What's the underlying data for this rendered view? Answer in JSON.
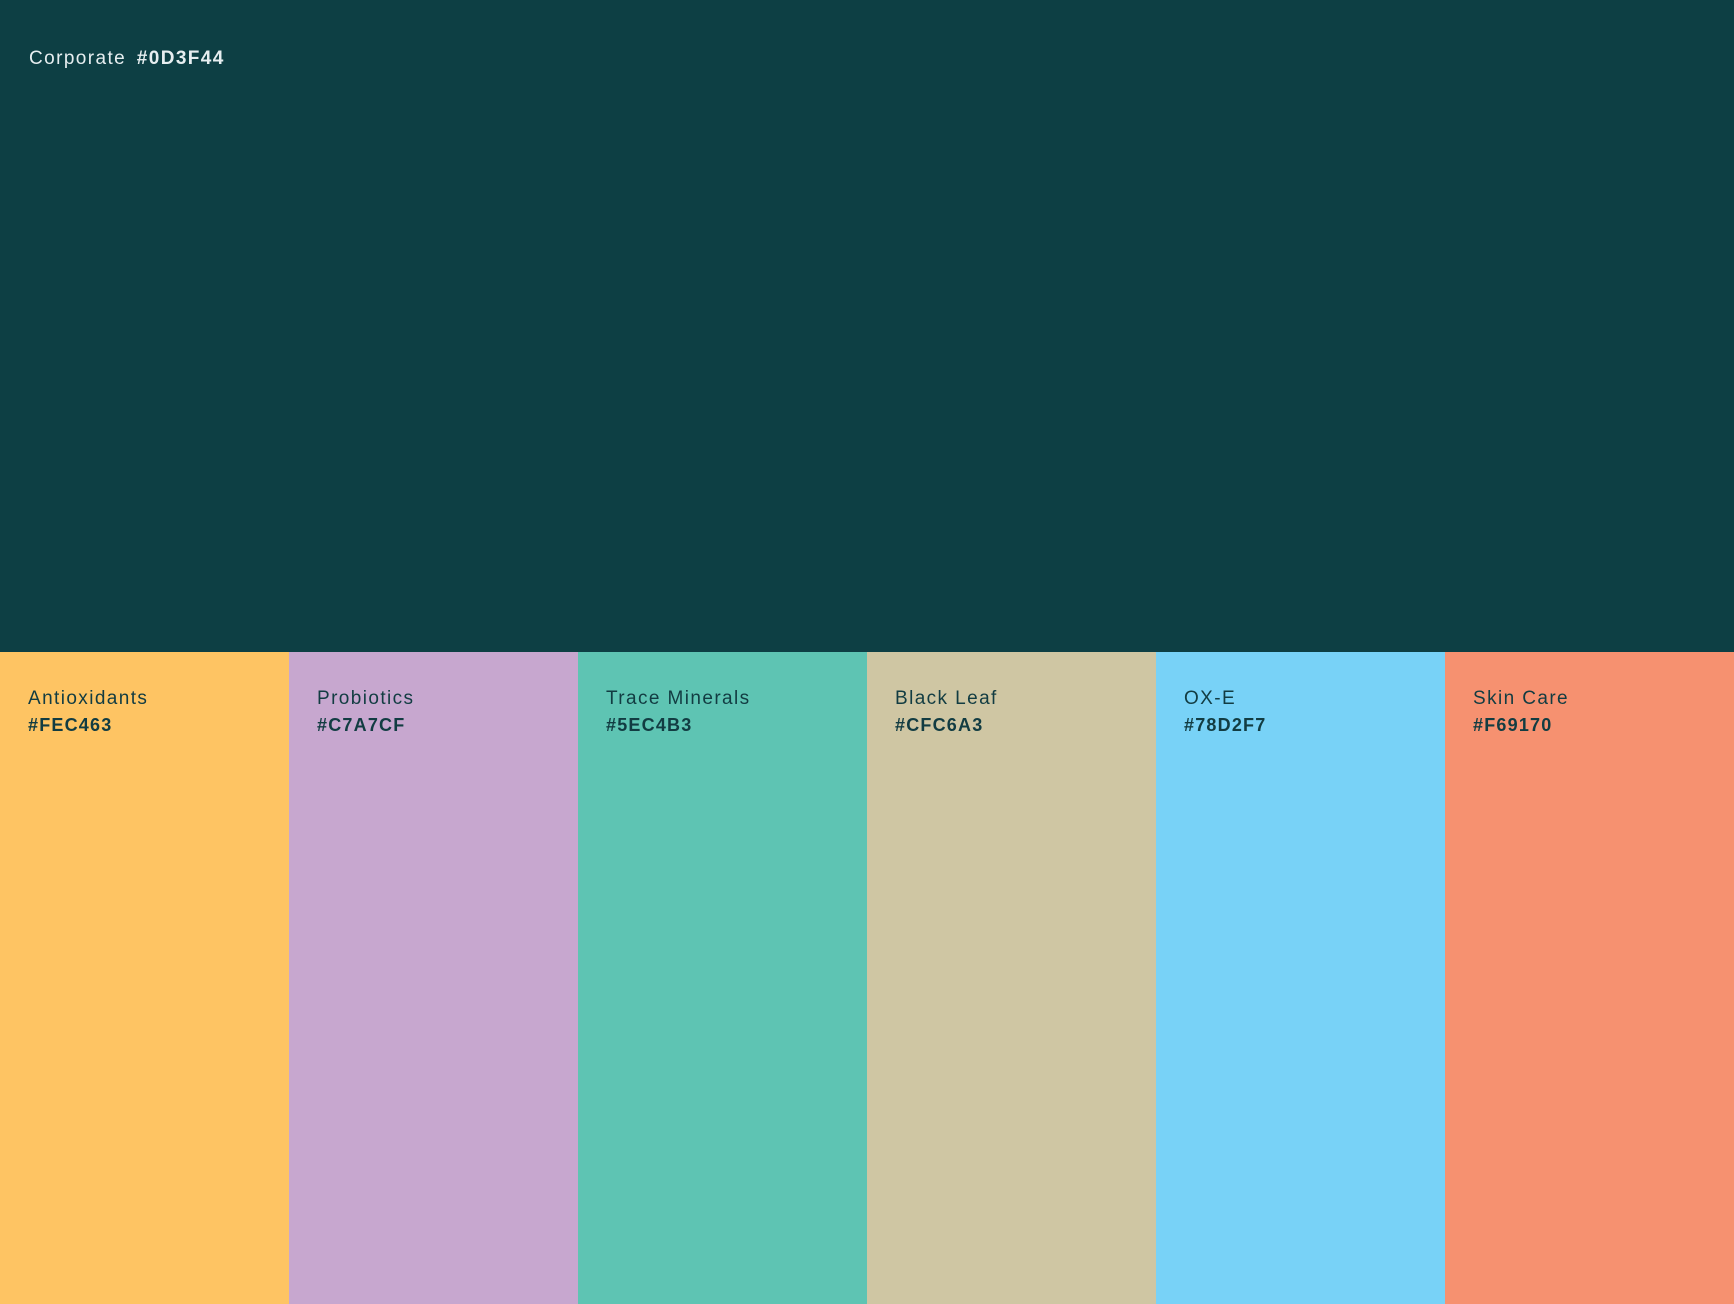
{
  "primary": {
    "name": "Corporate",
    "hex": "#0D3F44",
    "color": "#0D3F44"
  },
  "swatches": [
    {
      "name": "Antioxidants",
      "hex": "#FEC463",
      "color": "#FEC463"
    },
    {
      "name": "Probiotics",
      "hex": "#C7A7CF",
      "color": "#C7A7CF"
    },
    {
      "name": "Trace Minerals",
      "hex": "#5EC4B3",
      "color": "#5EC4B3"
    },
    {
      "name": "Black Leaf",
      "hex": "#CFC6A3",
      "color": "#CFC6A3"
    },
    {
      "name": "OX-E",
      "hex": "#78D2F7",
      "color": "#78D2F7"
    },
    {
      "name": "Skin Care",
      "hex": "#F69170",
      "color": "#F69170"
    }
  ]
}
